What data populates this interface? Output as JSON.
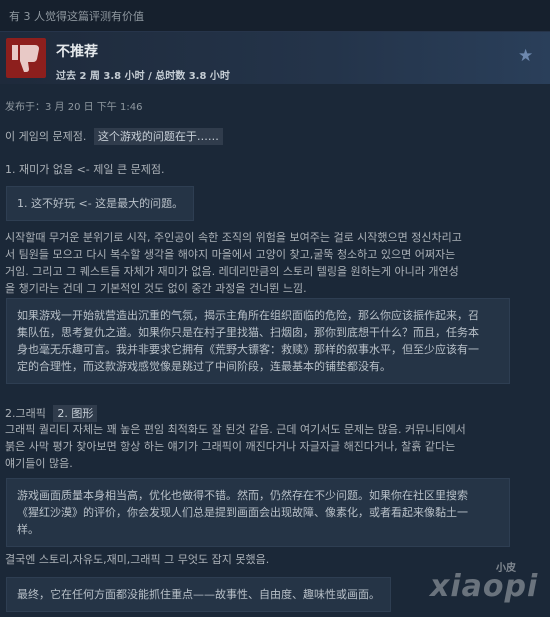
{
  "helpful_text": "有 3 人觉得这篇评测有价值",
  "review": {
    "verdict": "不推荐",
    "hours": "过去 2 周 3.8 小时 / 总时数 3.8 小时",
    "posted": "发布于：3 月 20 日 下午 1:46"
  },
  "intro": {
    "korean": "이 게임의 문제점.",
    "chinese": "这个游戏的问题在于……"
  },
  "section1": {
    "heading": "1. 재미가 없음 <- 제일 큰 문제점.",
    "quote": "1. 这不好玩 <- 这是最大的问题。",
    "body": [
      "시작할때 무거운 분위기로 시작, 주인공이 속한 조직의 위험을 보여주는 걸로 시작했으면 정신차리고",
      "서 팀원들 모으고 다시 복수할 생각을 해야지 마을에서 고양이 찾고,굴뚝 청소하고 있으면 어쩌자는",
      "거임. 그리고 그 퀘스트들 자체가 재미가 없음. 레데리만큼의 스토리 텔링을 원하는게 아니라 개연성",
      "을 챙기라는 건데 그 기본적인 것도 없이 중간 과정을 건너뛴 느낌."
    ],
    "translation": [
      "如果游戏一开始就营造出沉重的气氛，揭示主角所在组织面临的危险，那么你应该振作起来，召",
      "集队伍，思考复仇之道。如果你只是在村子里找猫、扫烟囱，那你到底想干什么？而且，任务本",
      "身也毫无乐趣可言。我并非要求它拥有《荒野大镖客：救赎》那样的叙事水平，但至少应该有一",
      "定的合理性，而这款游戏感觉像是跳过了中间阶段，连最基本的铺垫都没有。"
    ]
  },
  "section2": {
    "heading_korean": "2.그래픽",
    "heading_chinese": "2. 图形",
    "body": [
      "그래픽 퀄리티 자체는 꽤 높은 편임 최적화도 잘 된것 같음. 근데 여기서도 문제는 많음. 커뮤니티에서",
      "붉은 사막 평가 찾아보면 항상 하는 얘기가 그래픽이 깨진다거나 자글자글 해진다거나, 찰흙 같다는",
      "얘기들이 많음."
    ],
    "translation": [
      "游戏画面质量本身相当高，优化也做得不错。然而，仍然存在不少问题。如果你在社区里搜索",
      "《猩红沙漠》的评价，你会发现人们总是提到画面会出现故障、像素化，或者看起来像黏土一",
      "样。"
    ]
  },
  "conclusion": {
    "korean": "결국엔 스토리,자유도,재미,그래픽 그 무엇도 잡지 못했음.",
    "chinese": "最终，它在任何方面都没能抓住重点——故事性、自由度、趣味性或画面。"
  },
  "watermark": {
    "small": "小皮",
    "name": "xiaopi"
  },
  "colors": {
    "background": "#1b2838",
    "thumb_red": "#8d1f1d",
    "quote_bg": "#253446"
  }
}
